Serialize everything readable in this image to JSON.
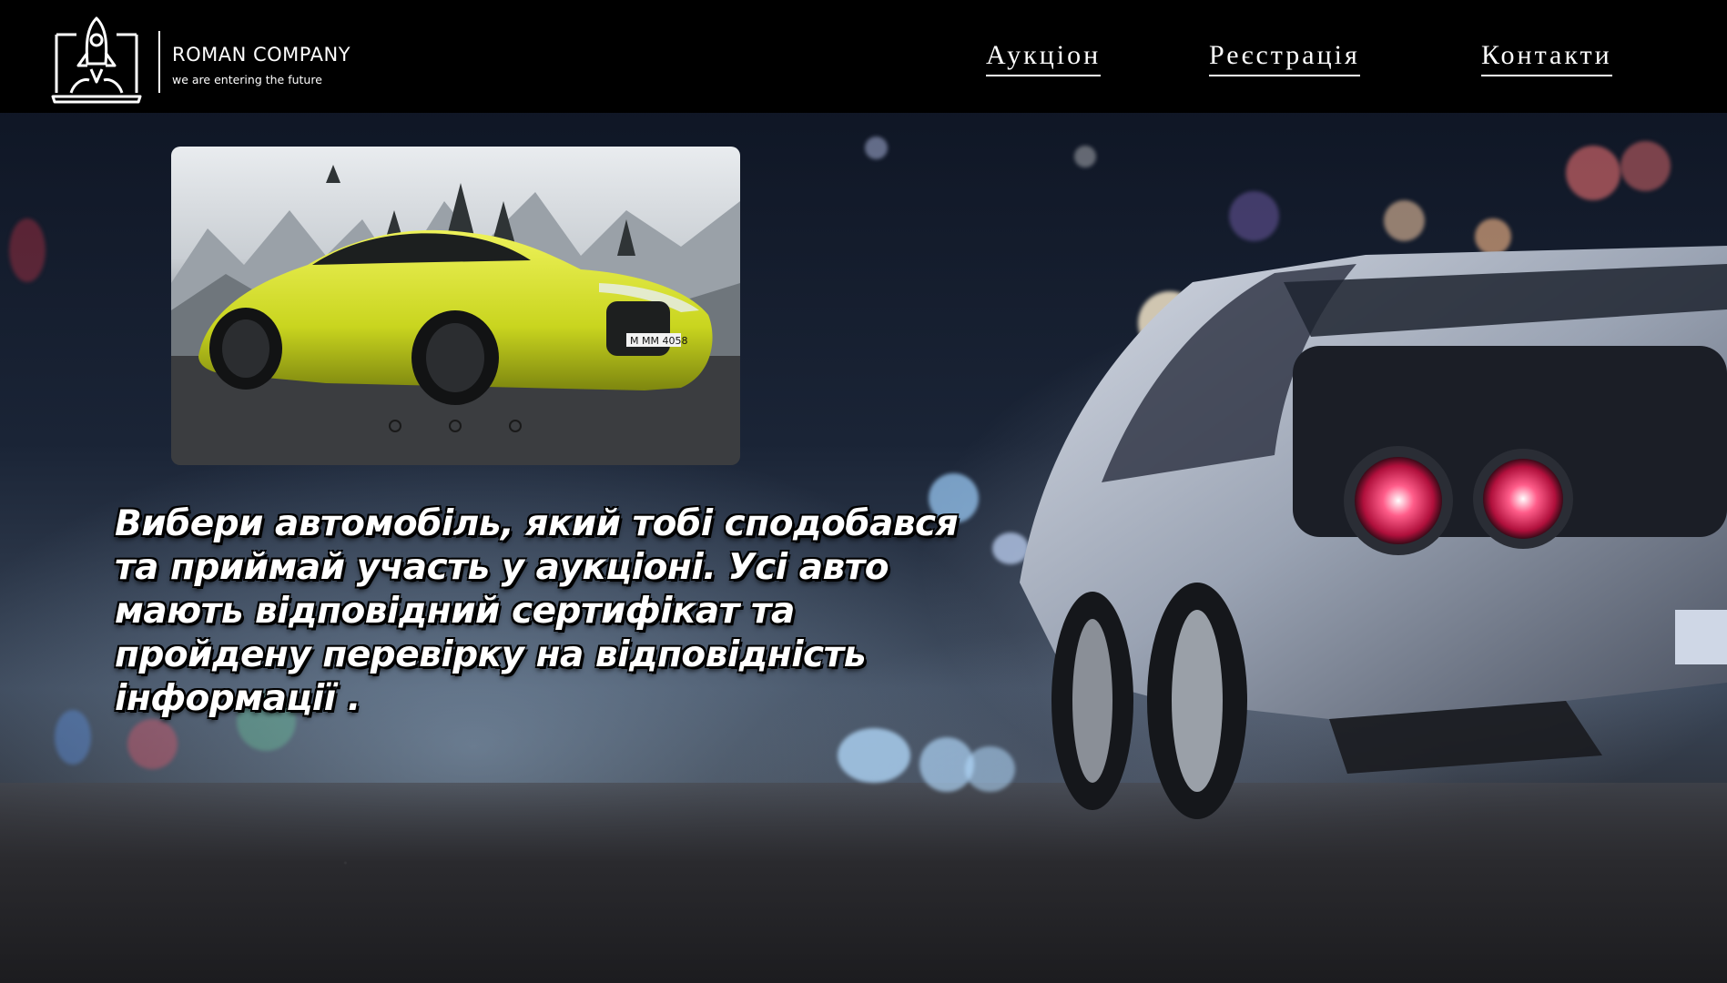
{
  "brand": {
    "name": "ROMAN COMPANY",
    "tagline": "we are entering the future",
    "logo_icon": "rocket-laptop-icon"
  },
  "nav": {
    "items": [
      {
        "label": "Аукціон"
      },
      {
        "label": "Реєстрація"
      },
      {
        "label": "Контакти"
      }
    ]
  },
  "slider": {
    "current_slide": 1,
    "slide_count": 3,
    "plate_text": "M MM 4058"
  },
  "hero": {
    "text": "Вибери автомобіль, який тобі сподобався та приймай участь у аукціоні. Усі авто мають відповідний сертифікат та пройдену перевірку на відповідність інформації ."
  },
  "colors": {
    "header_bg": "#000000",
    "text": "#ffffff",
    "car_yellow": "#d4e021"
  }
}
